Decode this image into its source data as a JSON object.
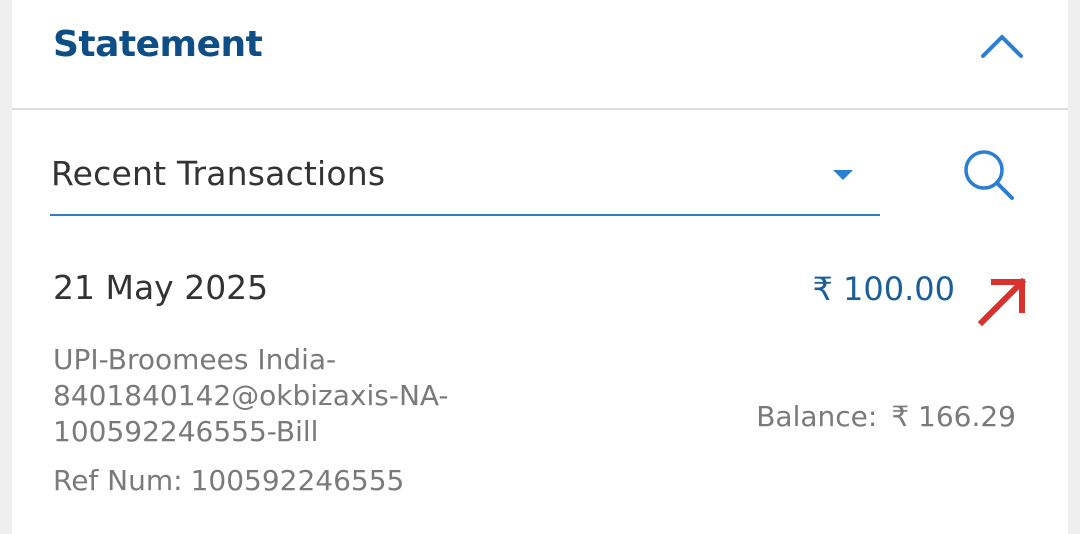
{
  "header": {
    "title": "Statement",
    "collapse_icon": "chevron-up-icon"
  },
  "filter": {
    "selected": "Recent Transactions",
    "dropdown_icon": "caret-down-icon",
    "search_icon": "search-icon"
  },
  "transaction": {
    "date": "21 May 2025",
    "amount": "₹ 100.00",
    "direction_icon": "arrow-up-right-icon",
    "description_lines": [
      "UPI-Broomees India-",
      "8401840142@okbizaxis-NA-",
      "100592246555-Bill"
    ],
    "balance_label": "Balance:",
    "balance_value": "₹ 166.29",
    "ref_label": "Ref Num:",
    "ref_value": "100592246555"
  },
  "colors": {
    "title": "#0d4e86",
    "accent": "#2a7ed3",
    "amount": "#1b5f99",
    "debit_arrow": "#d9312b",
    "secondary_text": "#7a7a7a"
  }
}
